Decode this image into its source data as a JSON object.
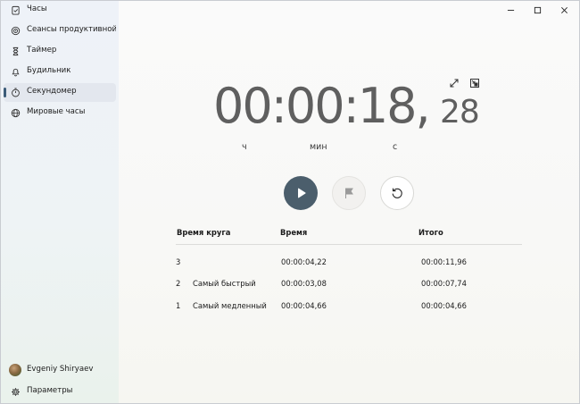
{
  "sidebar": {
    "items": [
      {
        "label": "Часы",
        "icon": "clipboard-check-icon"
      },
      {
        "label": "Сеансы продуктивной р",
        "icon": "focus-target-icon"
      },
      {
        "label": "Таймер",
        "icon": "hourglass-icon"
      },
      {
        "label": "Будильник",
        "icon": "bell-icon"
      },
      {
        "label": "Секундомер",
        "icon": "stopwatch-icon",
        "active": true
      },
      {
        "label": "Мировые часы",
        "icon": "globe-icon"
      }
    ],
    "profile": {
      "name": "Evgeniy Shiryaev"
    },
    "settings": {
      "label": "Параметры",
      "icon": "gear-icon"
    }
  },
  "window_controls": [
    "minimize-icon",
    "maximize-icon",
    "close-icon"
  ],
  "stopwatch": {
    "main_time": "00:00:18,",
    "centiseconds": "28",
    "units": {
      "hours": "ч",
      "minutes": "мин",
      "seconds": "с"
    }
  },
  "laps": {
    "headers": {
      "lap_time": "Время круга",
      "time": "Время",
      "total": "Итого"
    },
    "rows": [
      {
        "num": "3",
        "tag": "",
        "time": "00:00:04,22",
        "total": "00:00:11,96"
      },
      {
        "num": "2",
        "tag": "Самый быстрый",
        "time": "00:00:03,08",
        "total": "00:00:07,74"
      },
      {
        "num": "1",
        "tag": "Самый медленный",
        "time": "00:00:04,66",
        "total": "00:00:04,66"
      }
    ]
  },
  "colors": {
    "accent": "#3b5b78",
    "play_button": "#4b5e6c",
    "timer_text": "#5f5f5f"
  }
}
